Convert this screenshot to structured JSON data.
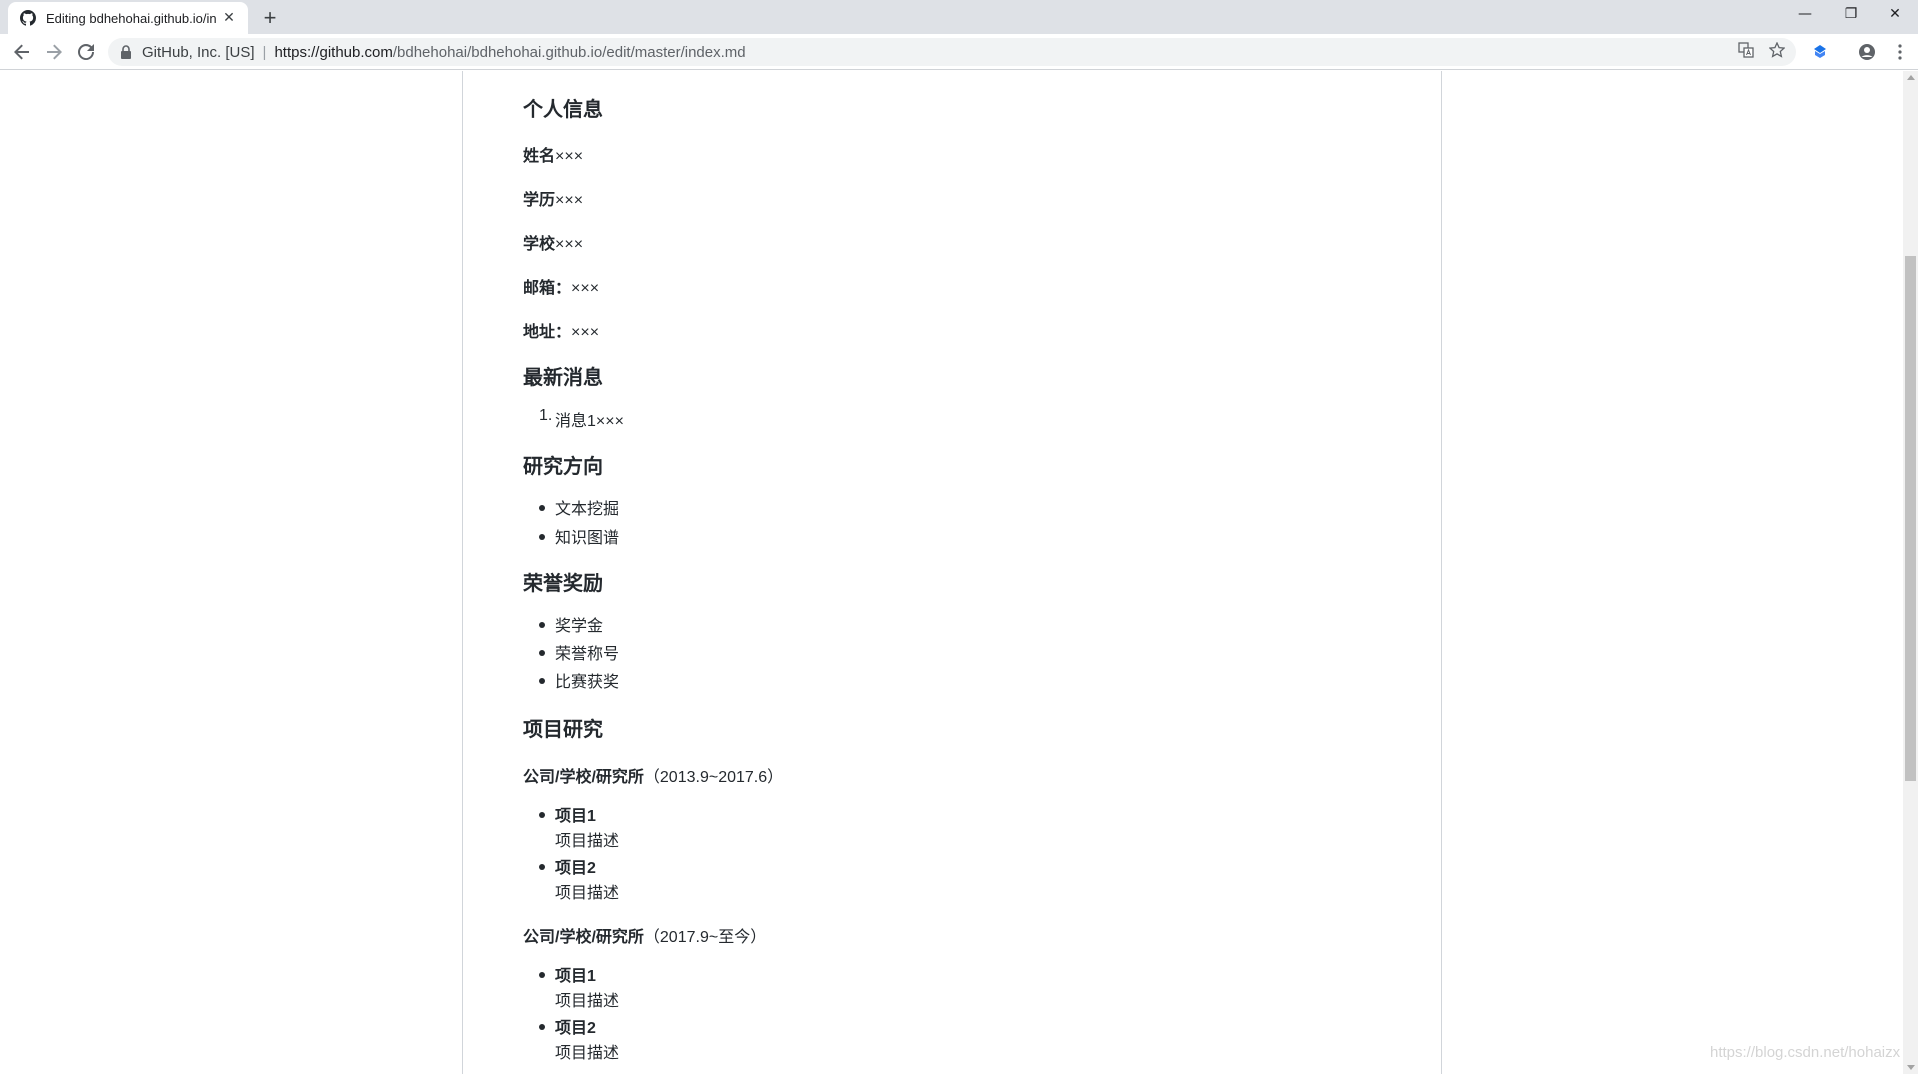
{
  "browser": {
    "tab_title": "Editing bdhehohai.github.io/in",
    "tab_close": "✕",
    "new_tab": "+",
    "window_controls": {
      "minimize": "—",
      "restore": "❐",
      "close": "✕"
    },
    "site_identity": "GitHub, Inc. [US]",
    "separator": "|",
    "url_host": "https://github.com",
    "url_path": "/bdhehohai/bdhehohai.github.io/edit/master/index.md"
  },
  "doc": {
    "sections": {
      "personal": {
        "heading": "个人信息",
        "fields": [
          {
            "label": "姓名",
            "value": "×××"
          },
          {
            "label": "学历",
            "value": "×××"
          },
          {
            "label": "学校",
            "value": "×××"
          },
          {
            "label": "邮箱：",
            "value": "×××"
          },
          {
            "label": "地址：",
            "value": "×××"
          }
        ]
      },
      "news": {
        "heading": "最新消息",
        "items": [
          {
            "num": "1.",
            "text": "消息1×××"
          }
        ]
      },
      "research": {
        "heading": "研究方向",
        "items": [
          "文本挖掘",
          "知识图谱"
        ]
      },
      "awards": {
        "heading": "荣誉奖励",
        "items": [
          "奖学金",
          "荣誉称号",
          "比赛获奖"
        ]
      },
      "projects": {
        "heading": "项目研究",
        "groups": [
          {
            "org": "公司/学校/研究所",
            "period": "（2013.9~2017.6）",
            "items": [
              {
                "name": "项目1",
                "desc": "项目描述"
              },
              {
                "name": "项目2",
                "desc": "项目描述"
              }
            ]
          },
          {
            "org": "公司/学校/研究所",
            "period": "（2017.9~至今）",
            "items": [
              {
                "name": "项目1",
                "desc": "项目描述"
              },
              {
                "name": "项目2",
                "desc": "项目描述"
              }
            ]
          }
        ]
      }
    }
  },
  "watermark": "https://blog.csdn.net/hohaizx"
}
